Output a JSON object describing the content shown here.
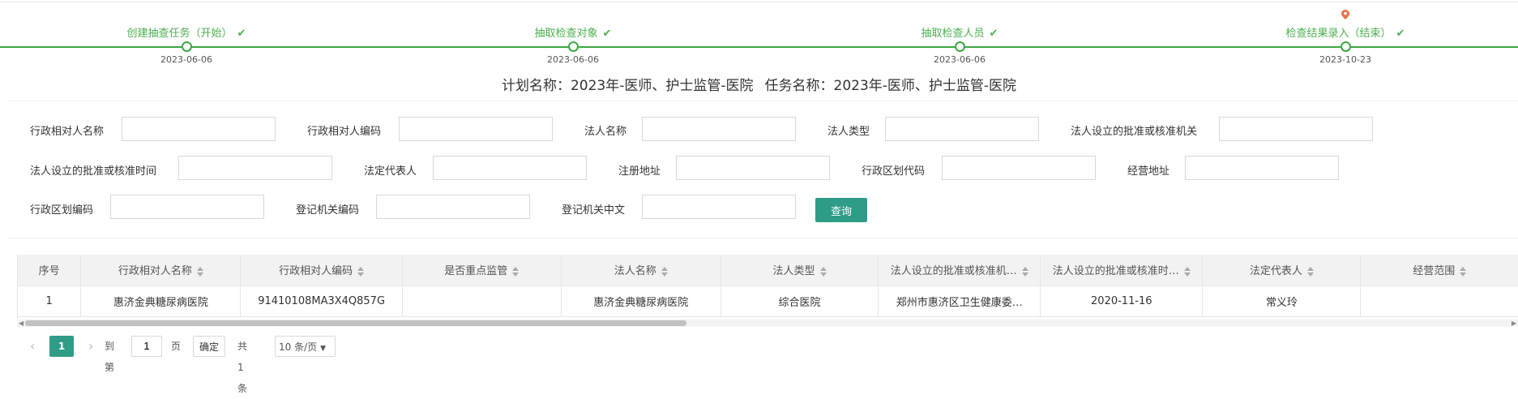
{
  "steps": [
    {
      "label": "创建抽查任务（开始）",
      "date": "2023-06-06"
    },
    {
      "label": "抽取检查对象",
      "date": "2023-06-06"
    },
    {
      "label": "抽取检查人员",
      "date": "2023-06-06"
    },
    {
      "label": "检查结果录入（结束）",
      "date": "2023-10-23"
    }
  ],
  "plan": {
    "plan_name": "计划名称：2023年-医师、护士监管-医院",
    "task_name": "任务名称：2023年-医师、护士监管-医院"
  },
  "search": {
    "fields": [
      "行政相对人名称",
      "行政相对人编码",
      "法人名称",
      "法人类型",
      "法人设立的批准或核准机关",
      "法人设立的批准或核准时间",
      "法定代表人",
      "注册地址",
      "行政区划代码",
      "经营地址",
      "行政区划编码",
      "登记机关编码",
      "登记机关中文"
    ],
    "query_label": "查询"
  },
  "table": {
    "headers": [
      "序号",
      "行政相对人名称",
      "行政相对人编码",
      "是否重点监管",
      "法人名称",
      "法人类型",
      "法人设立的批准或核准机…",
      "法人设立的批准或核准时…",
      "法定代表人",
      "经营范围"
    ],
    "rows": [
      [
        "1",
        "惠济金典糖尿病医院",
        "91410108MA3X4Q857G",
        "",
        "惠济金典糖尿病医院",
        "综合医院",
        "郑州市惠济区卫生健康委…",
        "2020-11-16",
        "常义玲",
        ""
      ]
    ]
  },
  "pager": {
    "prev": "‹",
    "current": "1",
    "next": "›",
    "goto_label": "到第",
    "goto_value": "1",
    "page_unit": "页",
    "confirm": "确定",
    "total": "共 1 条",
    "page_size": "10 条/页"
  },
  "colors": {
    "accent": "#2e9c87",
    "progress": "#3ea846",
    "pin": "#e8734a"
  }
}
